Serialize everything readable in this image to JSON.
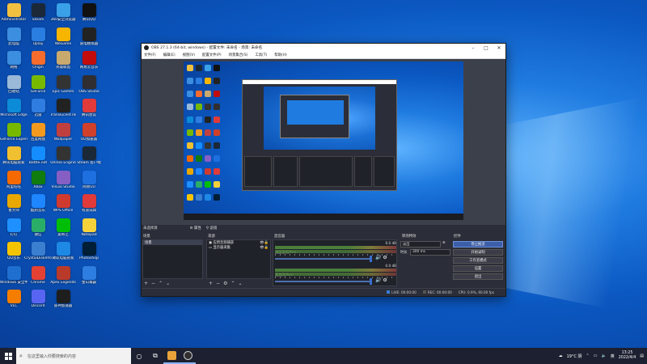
{
  "desktop": {
    "icons": [
      {
        "label": "Administrator",
        "color": "#f0c040"
      },
      {
        "label": "Steam",
        "color": "#1b2838"
      },
      {
        "label": "360安全浏览器",
        "color": "#3aa0e8"
      },
      {
        "label": "腾讯QQ",
        "color": "#111"
      },
      {
        "label": "此电脑",
        "color": "#3b8ee0"
      },
      {
        "label": "Uplay",
        "color": "#2a7de1"
      },
      {
        "label": "WeGame",
        "color": "#f7b500"
      },
      {
        "label": "雷电模拟器",
        "color": "#222"
      },
      {
        "label": "网络",
        "color": "#3b8ee0"
      },
      {
        "label": "Origin",
        "color": "#f56c2d"
      },
      {
        "label": "英雄联盟",
        "color": "#c8aa6e"
      },
      {
        "label": "网易云音乐",
        "color": "#c20c0c"
      },
      {
        "label": "回收站",
        "color": "#9ab8d8"
      },
      {
        "label": "GeForce",
        "color": "#76b900"
      },
      {
        "label": "Epic Games",
        "color": "#333"
      },
      {
        "label": "OBS Studio",
        "color": "#302e31"
      },
      {
        "label": "Microsoft Edge",
        "color": "#0c8cd8"
      },
      {
        "label": "迅雷",
        "color": "#2f7de1"
      },
      {
        "label": "TranslucentTB",
        "color": "#222"
      },
      {
        "label": "腾讯会议",
        "color": "#e03a3a"
      },
      {
        "label": "GeForce Experience",
        "color": "#76b900"
      },
      {
        "label": "百度网盘",
        "color": "#f39a1e"
      },
      {
        "label": "Wallpaper",
        "color": "#c04040"
      },
      {
        "label": "UU加速器",
        "color": "#d0402a"
      },
      {
        "label": "腾讯电脑管家",
        "color": "#f0c030"
      },
      {
        "label": "Battle.net",
        "color": "#148eff"
      },
      {
        "label": "Unreal Engine",
        "color": "#333"
      },
      {
        "label": "Steam 客户端",
        "color": "#1b2838"
      },
      {
        "label": "阿里旺旺",
        "color": "#f56a00"
      },
      {
        "label": "Xbox",
        "color": "#107c10"
      },
      {
        "label": "Visual Studio",
        "color": "#865fc5"
      },
      {
        "label": "网易UU",
        "color": "#1e6fe0"
      },
      {
        "label": "鲁大师",
        "color": "#e8a800"
      },
      {
        "label": "酷狗音乐",
        "color": "#1e86ff"
      },
      {
        "label": "WPS Office",
        "color": "#d03a2f"
      },
      {
        "label": "有道词典",
        "color": "#e03a3a"
      },
      {
        "label": "钉钉",
        "color": "#1e90ff"
      },
      {
        "label": "微信",
        "color": "#2aae67"
      },
      {
        "label": "爱奇艺",
        "color": "#00be06"
      },
      {
        "label": "Notepad",
        "color": "#f6d23a"
      },
      {
        "label": "QQ音乐",
        "color": "#f5c400"
      },
      {
        "label": "CrystalDiskInfo",
        "color": "#3a7fd0"
      },
      {
        "label": "微软电脑管家",
        "color": "#1e88e5"
      },
      {
        "label": "Photoshop",
        "color": "#001e36"
      },
      {
        "label": "Windows 安全中心",
        "color": "#1e6fd0"
      },
      {
        "label": "Chrome",
        "color": "#e34133"
      },
      {
        "label": "Apex Legends",
        "color": "#b83a2a"
      },
      {
        "label": "金山毒霸",
        "color": "#2e7de1"
      },
      {
        "label": "VLC",
        "color": "#f57e00"
      },
      {
        "label": "Discord",
        "color": "#5865f2"
      },
      {
        "label": "雷神加速器",
        "color": "#1e1e1e"
      }
    ]
  },
  "obs": {
    "title": "OBS 27.1.3 (64-bit, windows) - 配置文件: 未命名 - 场景: 未命名",
    "menu": [
      "文件(F)",
      "编辑(E)",
      "视图(V)",
      "配置文件(P)",
      "场景集合(S)",
      "工具(T)",
      "帮助(H)"
    ],
    "docks": {
      "scenes_title": "场景",
      "sources_title": "来源",
      "mixer_title": "混音器",
      "transitions_title": "转场特效",
      "controls_title": "控件",
      "not_selected": "未选择源",
      "properties_label": "属性",
      "filters_label": "滤镜"
    },
    "scenes": [
      "场景"
    ],
    "sources": [
      "应用音频捕获",
      "显示器采集"
    ],
    "mixer": [
      {
        "name": "桌面音频/Aux",
        "db": "0.0 dB"
      },
      {
        "name": "麦克风/Aux",
        "db": "0.0 dB"
      }
    ],
    "transitions": {
      "selected": "淡出",
      "duration_label": "时长",
      "duration_value": "300 ms"
    },
    "controls": [
      "停止推流",
      "开始录制",
      "工作室模式",
      "设置",
      "退出"
    ],
    "status": {
      "live": "LIVE: 00:00:00",
      "rec": "REC: 00:00:00",
      "cpu": "CPU: 0.9%, 60.00 fps"
    }
  },
  "taskbar": {
    "search_placeholder": "在这里输入你要搜索的内容",
    "weather": "19°C 阴",
    "time": "13:25",
    "date": "2022/4/4"
  },
  "colors": {
    "accent": "#3c5fa8",
    "taskbar": "#1c2030"
  }
}
